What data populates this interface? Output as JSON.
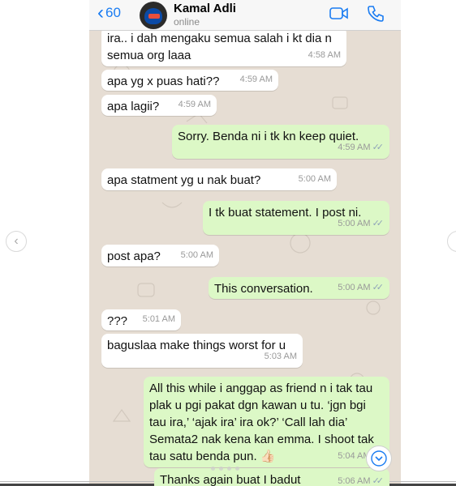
{
  "header": {
    "back_count": "60",
    "contact_name": "Kamal Adli",
    "contact_status": "online"
  },
  "messages": [
    {
      "dir": "in",
      "text": "ira.. i dah mengaku semua salah i kt dia n semua org laaa",
      "time": "4:58 AM"
    },
    {
      "dir": "in",
      "text": "apa yg x puas hati??",
      "time": "4:59 AM"
    },
    {
      "dir": "in",
      "text": "apa lagii?",
      "time": "4:59 AM"
    },
    {
      "dir": "out",
      "text": "Sorry. Benda ni i tk kn keep quiet.",
      "time": "4:59 AM"
    },
    {
      "dir": "in",
      "text": "apa statment yg u nak buat?",
      "time": "5:00 AM"
    },
    {
      "dir": "out",
      "text": "I tk buat statement. I post ni.",
      "time": "5:00 AM"
    },
    {
      "dir": "in",
      "text": "post apa?",
      "time": "5:00 AM"
    },
    {
      "dir": "out",
      "text": "This conversation.",
      "time": "5:00 AM"
    },
    {
      "dir": "in",
      "text": "???",
      "time": "5:01 AM"
    },
    {
      "dir": "in",
      "text": "baguslaa make things worst for u",
      "time": "5:03 AM"
    },
    {
      "dir": "out",
      "text": "All this while i anggap as friend n i tak tau plak u pgi pakat dgn kawan u tu. ‘jgn bgi tau ira,’ ‘ajak ira’ ira ok?’ ‘Call lah dia’ Semata2 nak kena kan emma. I shoot tak tau satu benda pun. 👍🏻",
      "time": "5:04 AM"
    },
    {
      "dir": "out",
      "text": "Thanks again buat I badut",
      "time": "5:06 AM"
    }
  ],
  "colors": {
    "accent": "#1a7cf2",
    "incoming_bubble": "#ffffff",
    "outgoing_bubble": "#dcf8c6",
    "chat_background": "#e6ddd3"
  },
  "icons": {
    "back": "chevron-left-icon",
    "video": "video-camera-icon",
    "call": "phone-icon",
    "scroll": "chevron-down-icon",
    "read": "double-check-icon"
  }
}
